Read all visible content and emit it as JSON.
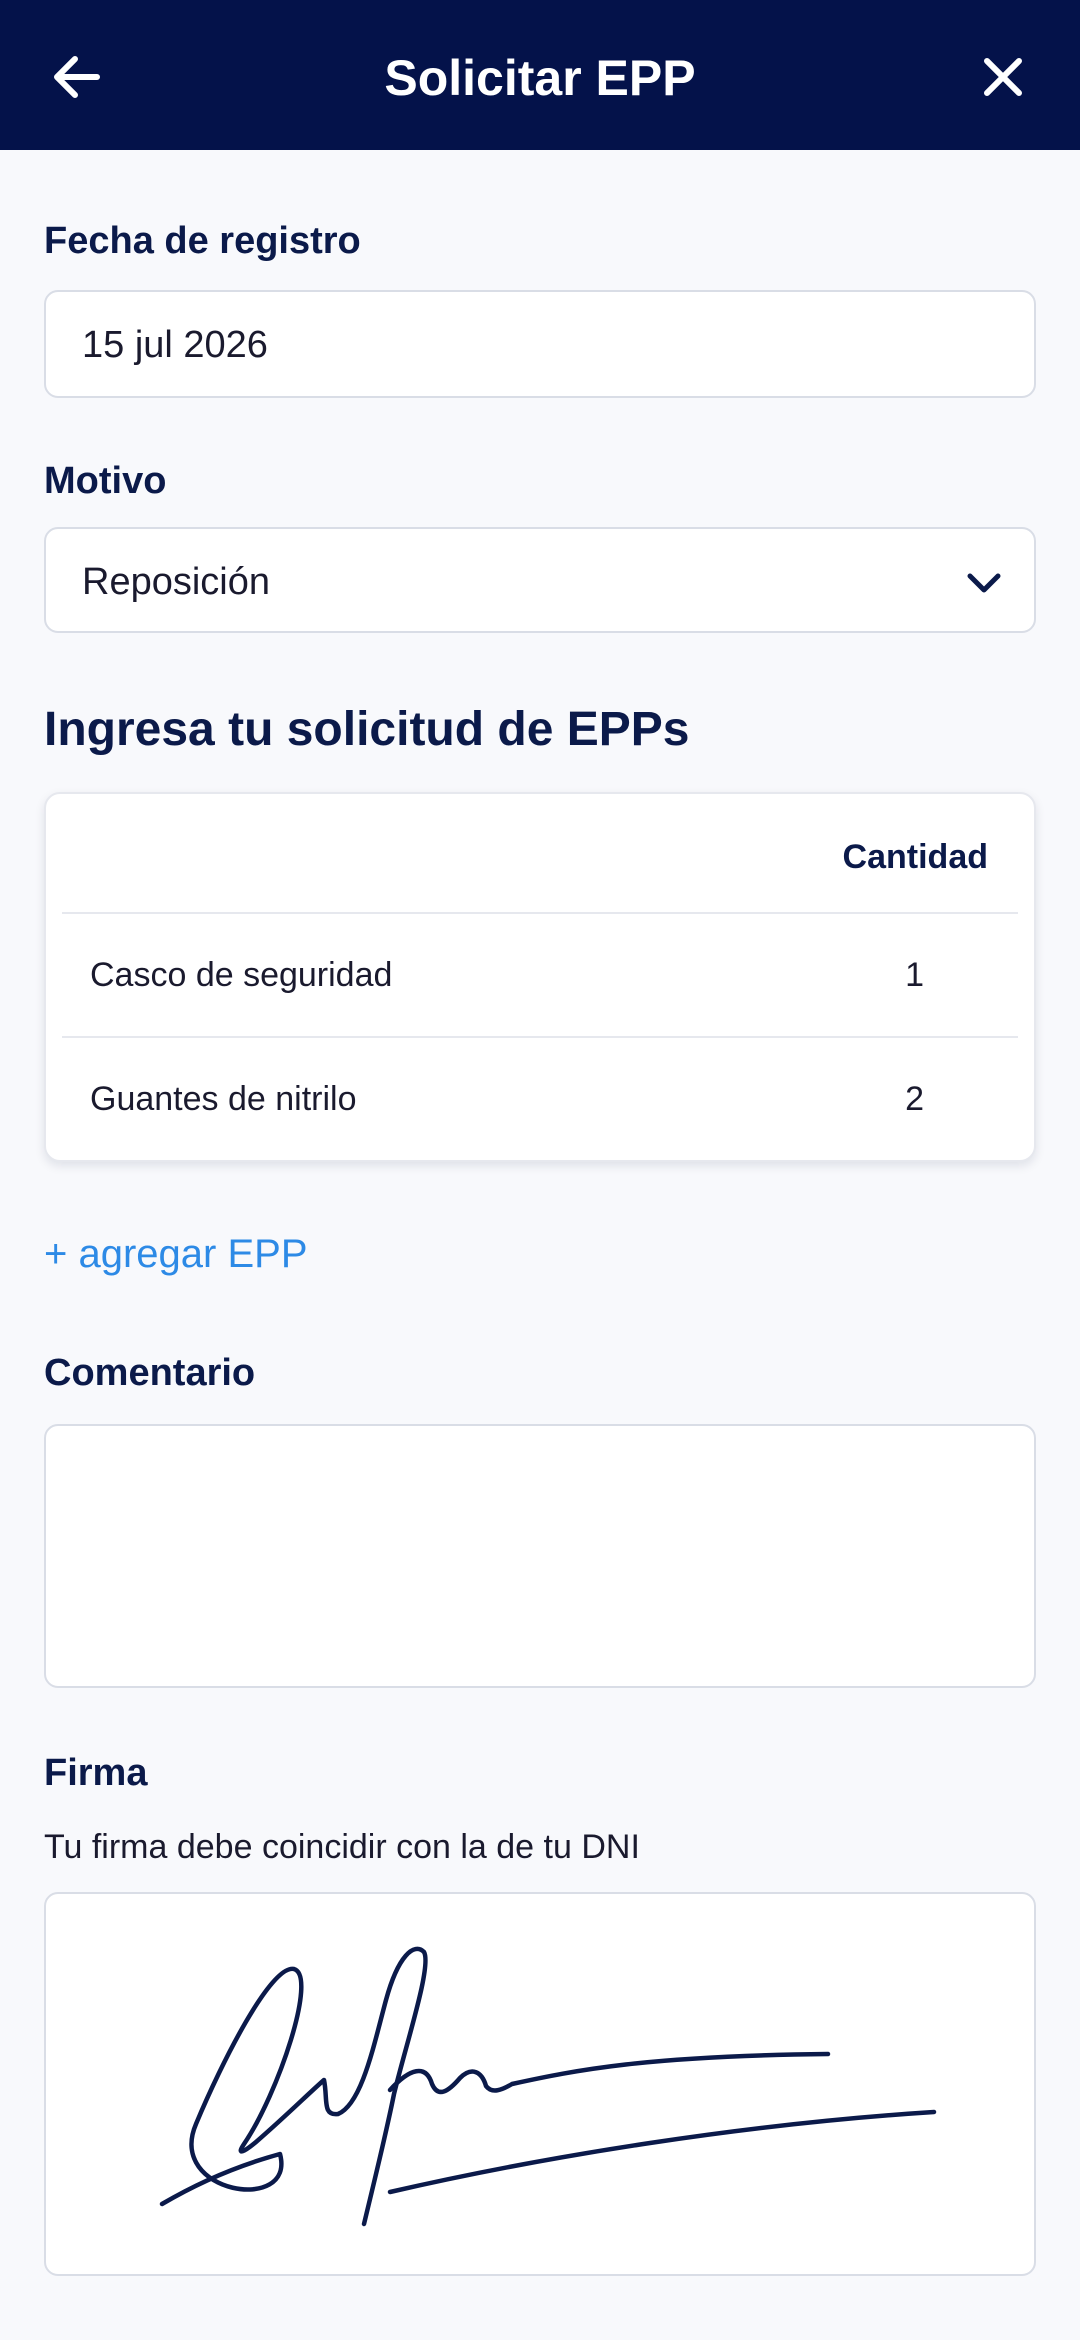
{
  "header": {
    "title": "Solicitar EPP",
    "back_icon": "arrow-left-icon",
    "close_icon": "close-icon",
    "background_color": "#04124a"
  },
  "form": {
    "date": {
      "label": "Fecha de registro",
      "value": "15 jul 2026"
    },
    "reason": {
      "label": "Motivo",
      "value": "Reposición"
    },
    "request_section": {
      "title": "Ingresa tu solicitud de EPPs",
      "columns": {
        "quantity": "Cantidad"
      },
      "items": [
        {
          "name": "Casco de seguridad",
          "quantity": "1"
        },
        {
          "name": "Guantes de nitrilo",
          "quantity": "2"
        }
      ],
      "add_link": "+ agregar EPP"
    },
    "comment": {
      "label": "Comentario",
      "value": ""
    },
    "signature": {
      "label": "Firma",
      "hint": "Tu firma debe coincidir con la de tu DNI"
    }
  },
  "colors": {
    "primary": "#04124a",
    "link": "#2d8ae6",
    "border": "#d9dde6",
    "background": "#f8f9fc"
  }
}
